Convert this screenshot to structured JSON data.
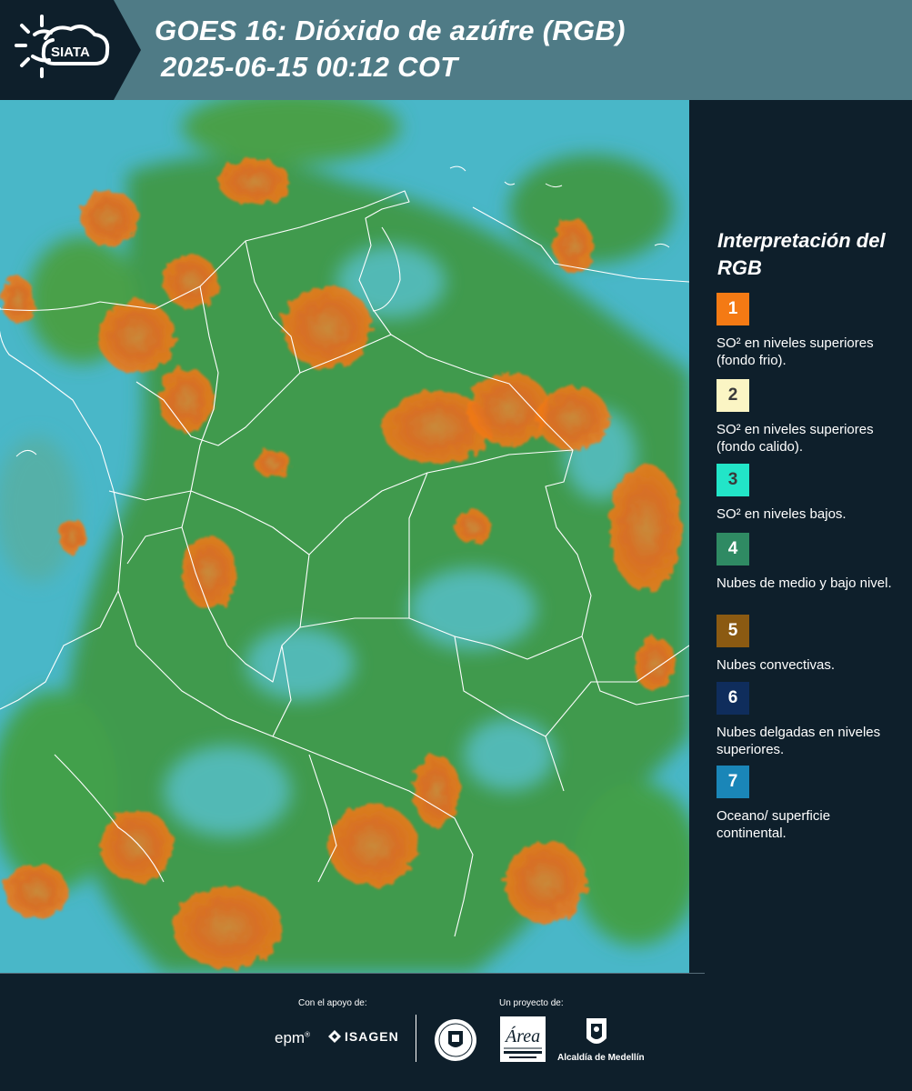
{
  "header": {
    "title": "GOES 16: Dióxido de azúfre (RGB)",
    "timestamp": "2025-06-15 00:12 COT",
    "logo_text": "SIATA"
  },
  "legend": {
    "title": "Interpretación del RGB",
    "items": [
      {
        "number": "1",
        "color": "#f47a14",
        "label": "SO² en niveles superiores (fondo frio)."
      },
      {
        "number": "2",
        "color": "#fbf5c4",
        "label": "SO² en niveles superiores (fondo calido)."
      },
      {
        "number": "3",
        "color": "#22e5c8",
        "label": "SO² en niveles bajos."
      },
      {
        "number": "4",
        "color": "#2f8a63",
        "label": "Nubes de medio y bajo nivel."
      },
      {
        "number": "5",
        "color": "#8b5a12",
        "label": "Nubes convectivas."
      },
      {
        "number": "6",
        "color": "#0f2d5c",
        "label": "Nubes delgadas en niveles superiores."
      },
      {
        "number": "7",
        "color": "#1a86b8",
        "label": "Oceano/ superficie continental."
      }
    ]
  },
  "footer": {
    "support_caption": "Con el apoyo de:",
    "project_caption": "Un proyecto de:",
    "sponsor_1": "epm",
    "sponsor_2": "ISAGEN",
    "partner_3": "Alcaldía de Medellín"
  },
  "map_colors": {
    "ocean_surface": "#49b7c8",
    "low_clouds": "#2f8a53",
    "so2_upper": "#f47a14",
    "borders": "#ffffff"
  }
}
